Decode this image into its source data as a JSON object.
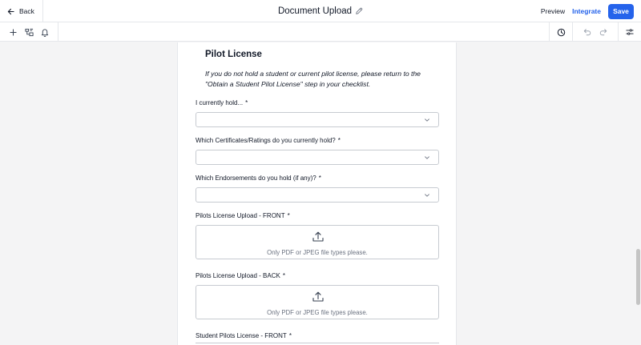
{
  "header": {
    "back_label": "Back",
    "title": "Document Upload",
    "preview_label": "Preview",
    "integrate_label": "Integrate",
    "save_label": "Save",
    "accent_color": "#2563eb"
  },
  "toolbar": {
    "left_icons": [
      "plus-icon",
      "field-group-icon",
      "bell-icon"
    ],
    "right_icons": [
      "history-icon",
      "undo-icon",
      "redo-icon",
      "settings-sliders-icon"
    ]
  },
  "form": {
    "section_title": "Pilot License",
    "instruction": "If you do not hold a student or current pilot license, please return to the \"Obtain a Student Pilot License\" step in your checklist.",
    "fields": [
      {
        "label": "I currently hold...",
        "required": "*",
        "type": "select",
        "value": ""
      },
      {
        "label": "Which Certificates/Ratings do you currently hold?",
        "required": "*",
        "type": "select",
        "value": ""
      },
      {
        "label": "Which Endorsements do you hold (if any)?",
        "required": "*",
        "type": "select",
        "value": ""
      },
      {
        "label": "Pilots License Upload - FRONT",
        "required": "*",
        "type": "upload",
        "hint": "Only PDF or JPEG file types please."
      },
      {
        "label": "Pilots License Upload - BACK",
        "required": "*",
        "type": "upload",
        "hint": "Only PDF or JPEG file types please."
      },
      {
        "label": "Student Pilots License - FRONT",
        "required": "*",
        "type": "upload",
        "hint": ""
      }
    ]
  }
}
